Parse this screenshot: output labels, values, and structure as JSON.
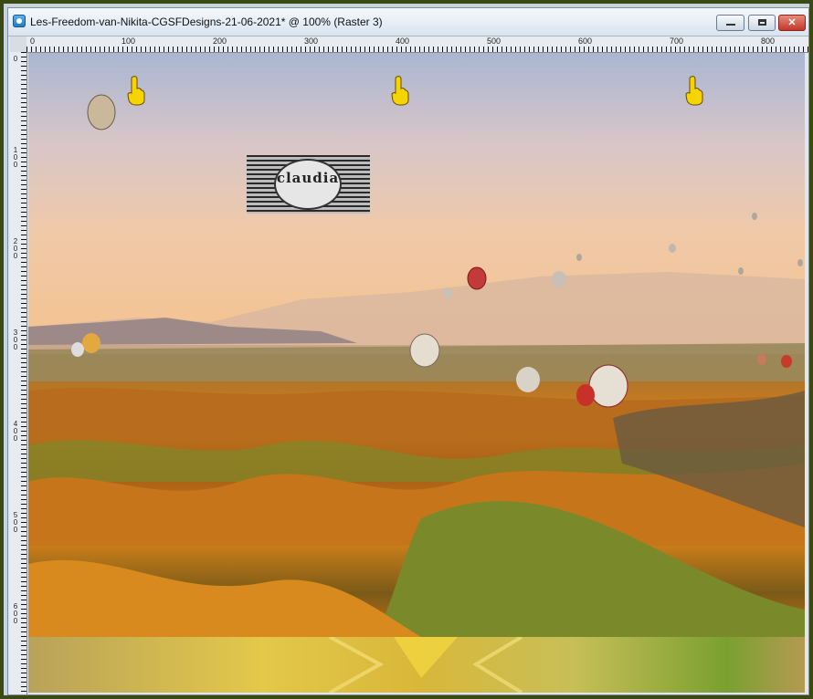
{
  "window": {
    "title": "Les-Freedom-van-Nikita-CGSFDesigns-21-06-2021* @ 100% (Raster 3)",
    "buttons": {
      "minimize": "minimize",
      "maximize": "maximize",
      "close": "✕"
    }
  },
  "rulers": {
    "horizontal_labels": [
      "0",
      "100",
      "200",
      "300",
      "400",
      "500",
      "600",
      "700",
      "800"
    ],
    "vertical_labels": [
      "0",
      "100",
      "200",
      "300",
      "400",
      "500",
      "600"
    ]
  },
  "canvas": {
    "watermark_text": "claudia",
    "icons": [
      "hand-pointer-icon",
      "hand-pointer-icon",
      "hand-pointer-icon"
    ]
  },
  "colors": {
    "frame": "#3b4a14",
    "close_button": "#c2372a",
    "pointer_hand": "#f5d400"
  }
}
